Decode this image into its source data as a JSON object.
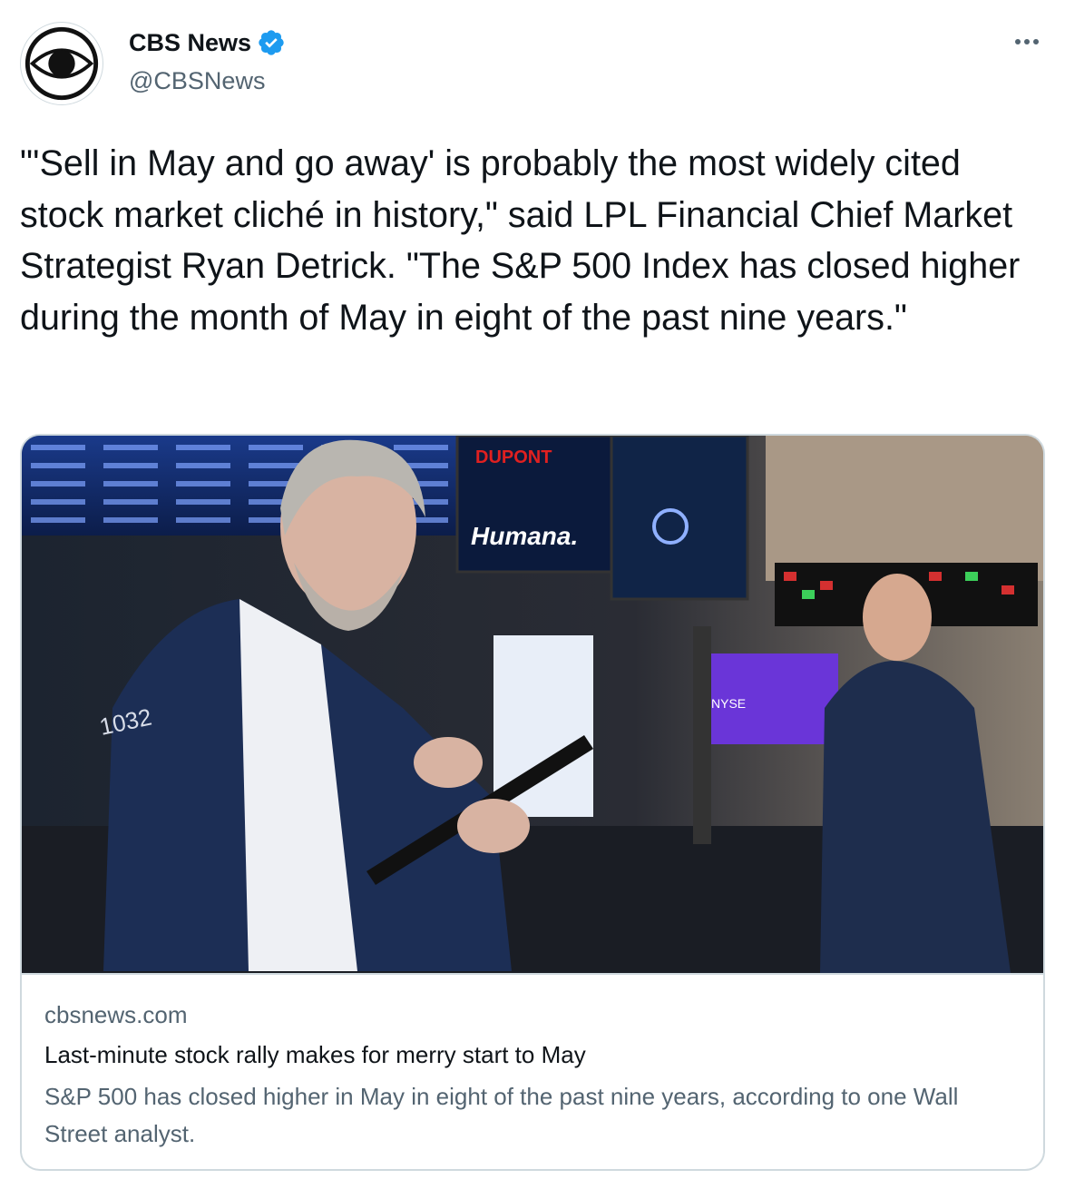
{
  "author": {
    "display_name": "CBS News",
    "handle": "@CBSNews",
    "verified": true,
    "avatar_icon": "cbs-eye-logo-icon"
  },
  "more_icon": "more-horizontal-icon",
  "tweet": {
    "text": "\"'Sell in May and go away' is probably the most widely cited stock market cliché in history,\" said LPL Financial Chief Market Strategist Ryan Detrick. \"The S&P 500 Index has closed higher during the month of May in eight of the past nine years.\""
  },
  "card": {
    "domain": "cbsnews.com",
    "title": "Last-minute stock rally makes for merry start to May",
    "description": "S&P 500 has closed higher in May in eight of the past nine years, according to one Wall Street analyst.",
    "image": {
      "ticker_labels": [
        "Humana.",
        "1032",
        "DUPONT",
        "NYSE"
      ]
    }
  },
  "colors": {
    "text_primary": "#0f1419",
    "text_secondary": "#536471",
    "border": "#cfd9de",
    "verified_blue": "#1d9bf0"
  }
}
